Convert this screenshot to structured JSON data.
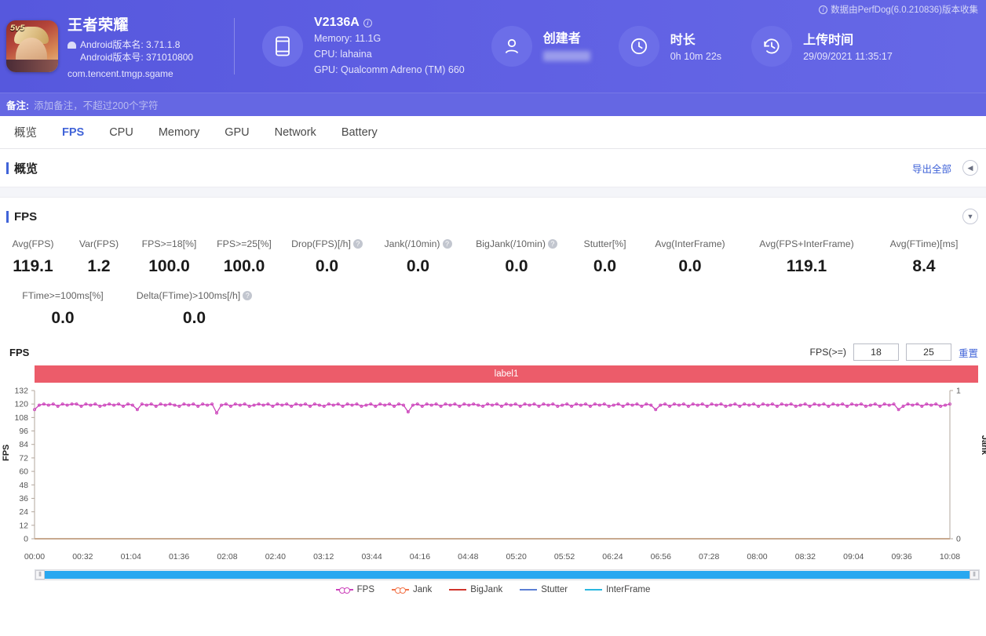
{
  "header": {
    "collect_note": "数据由PerfDog(6.0.210836)版本收集",
    "app": {
      "name": "王者荣耀",
      "version_name_label": "Android版本名: 3.71.1.8",
      "version_code_label": "Android版本号: 371010800",
      "package": "com.tencent.tmgp.sgame"
    },
    "device": {
      "model": "V2136A",
      "memory": "Memory: 11.1G",
      "cpu": "CPU: lahaina",
      "gpu": "GPU: Qualcomm Adreno (TM) 660"
    },
    "creator": {
      "title": "创建者",
      "value": ""
    },
    "duration": {
      "title": "时长",
      "value": "0h 10m 22s"
    },
    "upload": {
      "title": "上传时间",
      "value": "29/09/2021 11:35:17"
    }
  },
  "remark": {
    "label": "备注:",
    "placeholder": "添加备注，不超过200个字符",
    "value": ""
  },
  "tabs": [
    {
      "label": "概览",
      "active": false
    },
    {
      "label": "FPS",
      "active": true
    },
    {
      "label": "CPU",
      "active": false
    },
    {
      "label": "Memory",
      "active": false
    },
    {
      "label": "GPU",
      "active": false
    },
    {
      "label": "Network",
      "active": false
    },
    {
      "label": "Battery",
      "active": false
    }
  ],
  "overview": {
    "title": "概览",
    "export_all": "导出全部",
    "collapse_icon": "◀"
  },
  "fps_section": {
    "title": "FPS",
    "expand_icon": "▼"
  },
  "metrics_row1": [
    {
      "label": "Avg(FPS)",
      "value": "119.1",
      "help": false
    },
    {
      "label": "Var(FPS)",
      "value": "1.2",
      "help": false
    },
    {
      "label": "FPS>=18[%]",
      "value": "100.0",
      "help": false
    },
    {
      "label": "FPS>=25[%]",
      "value": "100.0",
      "help": false
    },
    {
      "label": "Drop(FPS)[/h]",
      "value": "0.0",
      "help": true
    },
    {
      "label": "Jank(/10min)",
      "value": "0.0",
      "help": true
    },
    {
      "label": "BigJank(/10min)",
      "value": "0.0",
      "help": true
    },
    {
      "label": "Stutter[%]",
      "value": "0.0",
      "help": false
    },
    {
      "label": "Avg(InterFrame)",
      "value": "0.0",
      "help": false
    },
    {
      "label": "Avg(FPS+InterFrame)",
      "value": "119.1",
      "help": false
    },
    {
      "label": "Avg(FTime)[ms]",
      "value": "8.4",
      "help": false
    }
  ],
  "metrics_row2": [
    {
      "label": "FTime>=100ms[%]",
      "value": "0.0",
      "help": false
    },
    {
      "label": "Delta(FTime)>100ms[/h]",
      "value": "0.0",
      "help": true
    }
  ],
  "chart_controls": {
    "chart_title": "FPS",
    "threshold_label": "FPS(>=)",
    "threshold_low": "18",
    "threshold_high": "25",
    "reset_label": "重置",
    "series_label": "label1"
  },
  "chart_data": {
    "type": "line",
    "title": "FPS",
    "xlabel": "",
    "ylabel": "FPS",
    "y2label": "Jank",
    "ylim": [
      0,
      132
    ],
    "y2lim": [
      0,
      1
    ],
    "grid": false,
    "legend_position": "bottom",
    "yticks": [
      0,
      12,
      24,
      36,
      48,
      60,
      72,
      84,
      96,
      108,
      120,
      132
    ],
    "y2ticks": [
      0,
      1
    ],
    "xticks": [
      "00:00",
      "00:32",
      "01:04",
      "01:36",
      "02:08",
      "02:40",
      "03:12",
      "03:44",
      "04:16",
      "04:48",
      "05:20",
      "05:52",
      "06:24",
      "06:56",
      "07:28",
      "08:00",
      "08:32",
      "09:04",
      "09:36",
      "10:08"
    ],
    "series": [
      {
        "name": "FPS",
        "color": "#cc44bb",
        "axis": "left",
        "avg": 119.1,
        "values": [
          115,
          119,
          120,
          119,
          120,
          118,
          120,
          119,
          120,
          120,
          118,
          120,
          119,
          120,
          118,
          119,
          120,
          119,
          120,
          118,
          120,
          119,
          115,
          120,
          119,
          120,
          118,
          120,
          119,
          120,
          119,
          118,
          120,
          119,
          120,
          118,
          120,
          119,
          120,
          112,
          119,
          120,
          118,
          120,
          119,
          120,
          118,
          119,
          120,
          119,
          120,
          118,
          120,
          119,
          120,
          118,
          120,
          119,
          120,
          118,
          120,
          119,
          118,
          120,
          119,
          120,
          118,
          120,
          119,
          120,
          118,
          119,
          120,
          118,
          120,
          119,
          120,
          118,
          120,
          119,
          113,
          119,
          120,
          118,
          120,
          119,
          120,
          118,
          120,
          119,
          120,
          118,
          120,
          119,
          120,
          119,
          118,
          120,
          119,
          120,
          118,
          120,
          119,
          120,
          118,
          120,
          119,
          120,
          118,
          120,
          119,
          120,
          118,
          119,
          120,
          118,
          120,
          119,
          120,
          118,
          120,
          119,
          120,
          118,
          119,
          120,
          118,
          120,
          119,
          120,
          118,
          120,
          119,
          115,
          119,
          120,
          118,
          120,
          119,
          120,
          118,
          120,
          119,
          120,
          118,
          120,
          119,
          120,
          118,
          119,
          120,
          118,
          120,
          119,
          120,
          118,
          120,
          119,
          120,
          118,
          120,
          119,
          120,
          118,
          119,
          120,
          118,
          120,
          119,
          120,
          118,
          120,
          119,
          120,
          118,
          120,
          119,
          120,
          118,
          119,
          120,
          118,
          120,
          119,
          120,
          115,
          118,
          120,
          119,
          120,
          118,
          120,
          119,
          120,
          118,
          119,
          120
        ]
      },
      {
        "name": "Jank",
        "color": "#f2744a",
        "axis": "right",
        "values": []
      },
      {
        "name": "BigJank",
        "color": "#d0342c",
        "axis": "right",
        "values": []
      },
      {
        "name": "Stutter",
        "color": "#5b7fd4",
        "axis": "right",
        "values": []
      },
      {
        "name": "InterFrame",
        "color": "#2bb8e0",
        "axis": "right",
        "values": []
      }
    ]
  },
  "legend": [
    {
      "label": "FPS",
      "color": "#cc44bb",
      "marker": "dot"
    },
    {
      "label": "Jank",
      "color": "#f2744a",
      "marker": "dot"
    },
    {
      "label": "BigJank",
      "color": "#d0342c",
      "marker": "line"
    },
    {
      "label": "Stutter",
      "color": "#5b7fd4",
      "marker": "line"
    },
    {
      "label": "InterFrame",
      "color": "#2bb8e0",
      "marker": "line"
    }
  ],
  "scrollbar": {
    "left_grip": "⦀",
    "right_grip": "⦀"
  }
}
